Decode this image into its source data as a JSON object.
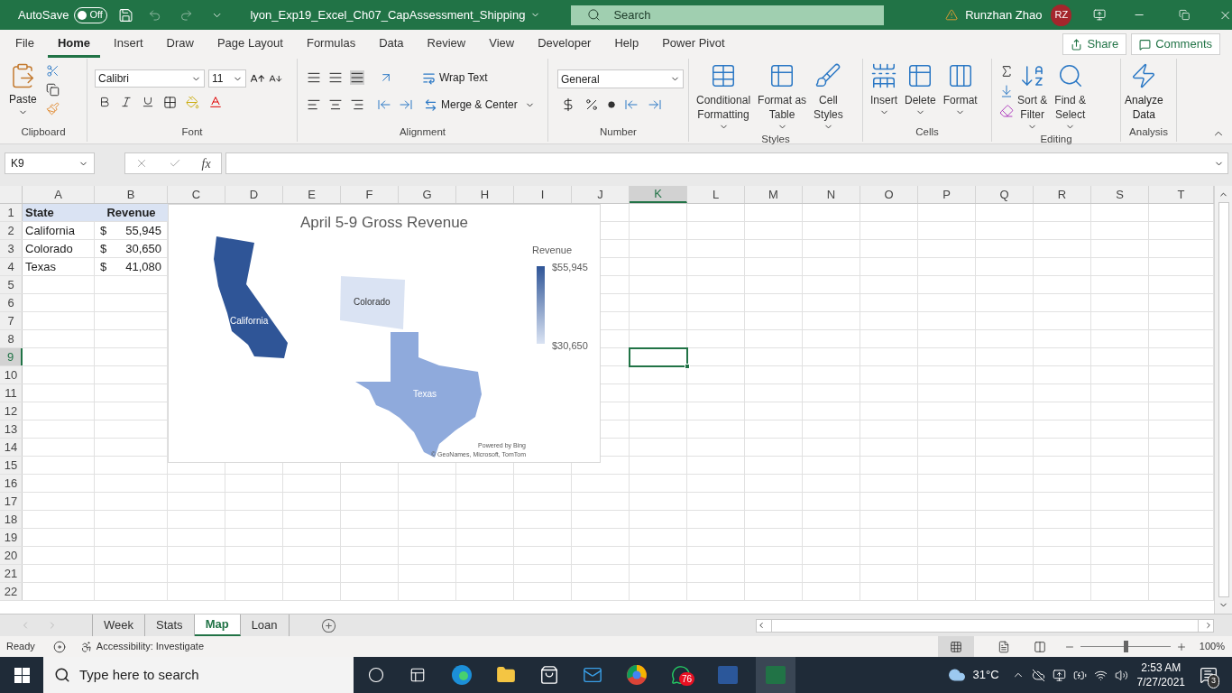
{
  "title_bar": {
    "autosave_label": "AutoSave",
    "autosave_toggle": {
      "label": "Off",
      "on": false
    },
    "file_name": "lyon_Exp19_Excel_Ch07_CapAssessment_Shipping",
    "search_placeholder": "Search",
    "user_name": "Runzhan Zhao",
    "user_initials": "RZ"
  },
  "menu_tabs": [
    {
      "label": "File",
      "selected": false
    },
    {
      "label": "Home",
      "selected": true
    },
    {
      "label": "Insert",
      "selected": false
    },
    {
      "label": "Draw",
      "selected": false
    },
    {
      "label": "Page Layout",
      "selected": false
    },
    {
      "label": "Formulas",
      "selected": false
    },
    {
      "label": "Data",
      "selected": false
    },
    {
      "label": "Review",
      "selected": false
    },
    {
      "label": "View",
      "selected": false
    },
    {
      "label": "Developer",
      "selected": false
    },
    {
      "label": "Help",
      "selected": false
    },
    {
      "label": "Power Pivot",
      "selected": false
    }
  ],
  "share_button": "Share",
  "comments_button": "Comments",
  "ribbon": {
    "clipboard": {
      "paste": "Paste",
      "label": "Clipboard"
    },
    "font": {
      "font_name": "Calibri",
      "font_size": "11",
      "label": "Font"
    },
    "alignment": {
      "wrap_text": "Wrap Text",
      "merge": "Merge & Center",
      "label": "Alignment"
    },
    "number": {
      "format": "General",
      "label": "Number"
    },
    "styles": {
      "buttons": [
        {
          "lines": [
            "Conditional",
            "Formatting"
          ]
        },
        {
          "lines": [
            "Format as",
            "Table"
          ]
        },
        {
          "lines": [
            "Cell",
            "Styles"
          ]
        }
      ],
      "label": "Styles"
    },
    "cells": {
      "buttons": [
        "Insert",
        "Delete",
        "Format"
      ],
      "label": "Cells"
    },
    "editing": {
      "buttons": [
        {
          "lines": [
            "Sort &",
            "Filter"
          ]
        },
        {
          "lines": [
            "Find &",
            "Select"
          ]
        }
      ],
      "label": "Editing"
    },
    "analysis": {
      "buttons": [
        {
          "lines": [
            "Analyze",
            "Data"
          ]
        }
      ],
      "label": "Analysis"
    }
  },
  "formula_bar": {
    "name_box": "K9",
    "fx_label": "fx"
  },
  "columns": [
    {
      "label": "A",
      "selected": false
    },
    {
      "label": "B",
      "selected": false
    },
    {
      "label": "C",
      "selected": false
    },
    {
      "label": "D",
      "selected": false
    },
    {
      "label": "E",
      "selected": false
    },
    {
      "label": "F",
      "selected": false
    },
    {
      "label": "G",
      "selected": false
    },
    {
      "label": "H",
      "selected": false
    },
    {
      "label": "I",
      "selected": false
    },
    {
      "label": "J",
      "selected": false
    },
    {
      "label": "K",
      "selected": true
    },
    {
      "label": "L",
      "selected": false
    },
    {
      "label": "M",
      "selected": false
    },
    {
      "label": "N",
      "selected": false
    },
    {
      "label": "O",
      "selected": false
    },
    {
      "label": "P",
      "selected": false
    },
    {
      "label": "Q",
      "selected": false
    },
    {
      "label": "R",
      "selected": false
    },
    {
      "label": "S",
      "selected": false
    },
    {
      "label": "T",
      "selected": false
    }
  ],
  "rows": [
    {
      "label": "1",
      "selected": false
    },
    {
      "label": "2",
      "selected": false
    },
    {
      "label": "3",
      "selected": false
    },
    {
      "label": "4",
      "selected": false
    },
    {
      "label": "5",
      "selected": false
    },
    {
      "label": "6",
      "selected": false
    },
    {
      "label": "7",
      "selected": false
    },
    {
      "label": "8",
      "selected": false
    },
    {
      "label": "9",
      "selected": true
    },
    {
      "label": "10",
      "selected": false
    },
    {
      "label": "11",
      "selected": false
    },
    {
      "label": "12",
      "selected": false
    },
    {
      "label": "13",
      "selected": false
    },
    {
      "label": "14",
      "selected": false
    },
    {
      "label": "15",
      "selected": false
    },
    {
      "label": "16",
      "selected": false
    },
    {
      "label": "17",
      "selected": false
    },
    {
      "label": "18",
      "selected": false
    },
    {
      "label": "19",
      "selected": false
    },
    {
      "label": "20",
      "selected": false
    },
    {
      "label": "21",
      "selected": false
    },
    {
      "label": "22",
      "selected": false
    }
  ],
  "table": {
    "headers": [
      "State",
      "Revenue"
    ],
    "rows": [
      {
        "state": "California",
        "currency": "$",
        "amount": "55,945"
      },
      {
        "state": "Colorado",
        "currency": "$",
        "amount": "30,650"
      },
      {
        "state": "Texas",
        "currency": "$",
        "amount": "41,080"
      }
    ]
  },
  "map_chart": {
    "title": "April 5-9 Gross Revenue",
    "legend": {
      "title": "Revenue",
      "max": "$55,945",
      "min": "$30,650"
    },
    "regions": [
      {
        "name": "California",
        "color": "#2f5597"
      },
      {
        "name": "Colorado",
        "color": "#dae3f3"
      },
      {
        "name": "Texas",
        "color": "#8faadc"
      }
    ],
    "attribution": [
      "Powered by Bing",
      "© GeoNames, Microsoft, TomTom"
    ]
  },
  "sheet_tabs": [
    {
      "label": "Week",
      "selected": false
    },
    {
      "label": "Stats",
      "selected": false
    },
    {
      "label": "Map",
      "selected": true
    },
    {
      "label": "Loan",
      "selected": false
    }
  ],
  "status_bar": {
    "status": "Ready",
    "accessibility": "Accessibility: Investigate",
    "zoom": {
      "level": 0.5,
      "reading": "100%"
    }
  },
  "taskbar": {
    "search_placeholder": "Type here to search",
    "whatsapp_badge": "76",
    "temperature": "31°C",
    "time": "2:53 AM",
    "date": "7/27/2021",
    "notifications": "3"
  }
}
